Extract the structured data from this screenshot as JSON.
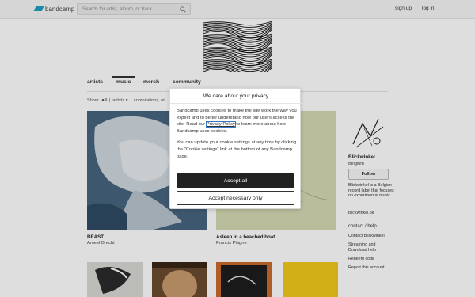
{
  "header": {
    "logo_text": "bandcamp",
    "search_placeholder": "Search for artist, album, or track",
    "signup_label": "sign up",
    "login_label": "log in"
  },
  "nav": {
    "tabs": [
      {
        "label": "artists"
      },
      {
        "label": "music",
        "active": true
      },
      {
        "label": "merch"
      },
      {
        "label": "community"
      }
    ],
    "filter": {
      "show_label": "Show:",
      "all_label": "all",
      "artists_label": "artists ▾",
      "separator": "|",
      "compilations_label": "compilations, et"
    }
  },
  "albums": [
    {
      "title": "BEAST",
      "artist": "Ameel Brecht"
    },
    {
      "title": "Asleep in a beached boat",
      "artist": "Francis Plagne"
    }
  ],
  "sidebar": {
    "label_name": "Blickwinkel",
    "location": "Belgium",
    "follow_label": "Follow",
    "bio": "Blickwinkel is a Belgian record label that focuses on experimental music.",
    "website": "blickwinkel.be",
    "contact_heading": "contact / help",
    "links": [
      {
        "label": "Contact Blickwinkel"
      },
      {
        "label": "Streaming and Download help"
      },
      {
        "label": "Redeem code"
      },
      {
        "label": "Report this account"
      }
    ]
  },
  "cookie_dialog": {
    "title": "We care about your privacy",
    "para1_before": "Bandcamp uses cookies to make the site work the way you expect and to better understand how our users access the site. Read our ",
    "policy_link": "Privacy Policy",
    "para1_after": " to learn more about how Bandcamp uses cookies.",
    "para2": "You can update your cookie settings at any time by clicking the \"Cookie settings\" link at the bottom of any Bandcamp page.",
    "accept_all_label": "Accept all",
    "accept_necessary_label": "Accept necessary only"
  },
  "colors": {
    "brand": "#1da0c3",
    "primary_button": "#222222",
    "focus_outline": "#3579c4"
  }
}
